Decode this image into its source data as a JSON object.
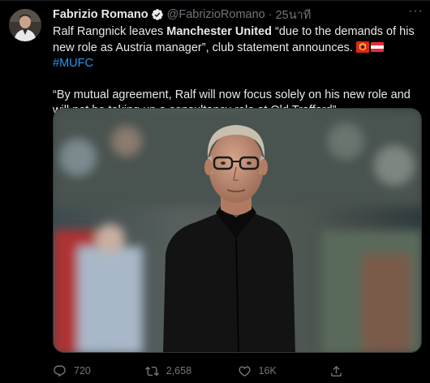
{
  "tweet": {
    "author": {
      "display_name": "Fabrizio Romano",
      "handle": "@FabrizioRomano",
      "verified": true
    },
    "separator": "·",
    "time": "25นาที",
    "more_label": "···",
    "text": {
      "line1_a": "Ralf Rangnick leaves ",
      "line1_bold": "Manchester United",
      "line1_b": " “due to the demands of his new role as Austria manager”, club statement announces. ",
      "flags": [
        "manchester-united-flag-emoji",
        "austria-flag-emoji"
      ],
      "hashtag": "#MUFC",
      "line2": "“By mutual agreement, Ralf will now focus solely on his new role and will not be taking up a consultancy role at Old Trafford”."
    },
    "media": {
      "type": "photo",
      "subject": "photo-ralf-rangnick"
    },
    "actions": {
      "reply_count": "720",
      "retweet_count": "2,658",
      "like_count": "16K"
    },
    "colors": {
      "background": "#000000",
      "text": "#e7e9ea",
      "secondary": "#71767b",
      "accent": "#1d9bf0",
      "verified": "#1d9bf0",
      "border": "#2f3336"
    }
  }
}
